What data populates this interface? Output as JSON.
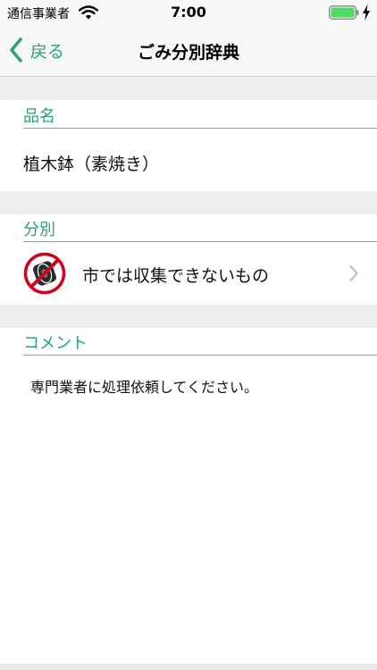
{
  "status_bar": {
    "carrier": "通信事業者",
    "time": "7:00"
  },
  "nav": {
    "back_label": "戻る",
    "title": "ごみ分別辞典"
  },
  "sections": {
    "item_name": {
      "header": "品名",
      "value": "植木鉢（素焼き）"
    },
    "category": {
      "header": "分別",
      "value": "市では収集できないもの",
      "icon": "no-tire-icon"
    },
    "comment": {
      "header": "コメント",
      "value": "専門業者に処理依頼してください。"
    }
  },
  "colors": {
    "accent": "#2aa36f",
    "prohibit": "#d0021b",
    "gap": "#efefef",
    "battery": "#4cd964"
  }
}
